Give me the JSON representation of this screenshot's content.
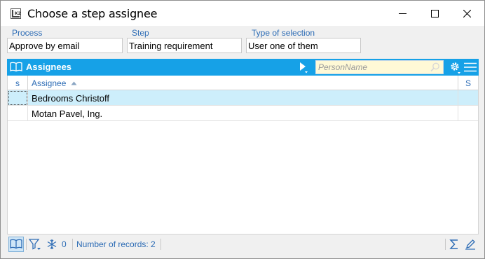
{
  "window": {
    "title": "Choose a step assignee",
    "app_icon": "k2-app-icon",
    "controls": [
      "minimize-icon",
      "maximize-icon",
      "close-icon"
    ]
  },
  "fields": {
    "process": {
      "label": "Process",
      "value": "Approve by email"
    },
    "step": {
      "label": "Step",
      "value": "Training requirement"
    },
    "selection_type": {
      "label": "Type of selection",
      "value": "User one of them"
    }
  },
  "panel": {
    "title": "Assignees",
    "search_placeholder": "PersonName",
    "icons": [
      "book-icon",
      "play-icon",
      "search-icon",
      "gear-icon",
      "menu-icon"
    ]
  },
  "grid": {
    "columns": [
      {
        "key": "s",
        "label": "s"
      },
      {
        "key": "assignee",
        "label": "Assignee",
        "sort": "ascending"
      },
      {
        "key": "S",
        "label": "S"
      }
    ],
    "rows": [
      {
        "assignee": "Bedrooms Christoff",
        "selected": true
      },
      {
        "assignee": "Motan Pavel, Ing.",
        "selected": false
      }
    ]
  },
  "statusbar": {
    "filter_count": "0",
    "records_text": "Number of records: 2",
    "icons": [
      "book-icon",
      "filter-icon",
      "snowflake-icon",
      "sigma-icon",
      "edit-icon"
    ]
  },
  "colors": {
    "accent": "#16a1e7",
    "label_blue": "#2d6cb5",
    "selected_row": "#cdeefb",
    "search_bg": "#fff9d6"
  }
}
